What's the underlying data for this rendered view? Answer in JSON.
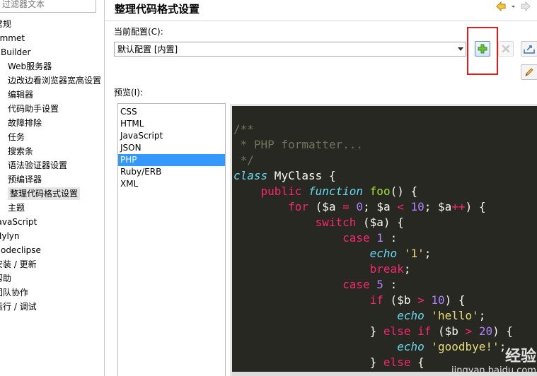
{
  "sidebar": {
    "filter_placeholder": "过滤器文本",
    "items": [
      {
        "label": "常规",
        "indent": 0
      },
      {
        "label": "Emmet",
        "indent": 0
      },
      {
        "label": "HBuilder",
        "indent": 0
      },
      {
        "label": "Web服务器",
        "indent": 1
      },
      {
        "label": "边改边看浏览器宽高设置",
        "indent": 1
      },
      {
        "label": "编辑器",
        "indent": 1
      },
      {
        "label": "代码助手设置",
        "indent": 1
      },
      {
        "label": "故障排除",
        "indent": 1
      },
      {
        "label": "任务",
        "indent": 1
      },
      {
        "label": "搜索条",
        "indent": 1
      },
      {
        "label": "语法验证器设置",
        "indent": 1
      },
      {
        "label": "预编译器",
        "indent": 1
      },
      {
        "label": "整理代码格式设置",
        "indent": 1,
        "selected": true
      },
      {
        "label": "主题",
        "indent": 1
      },
      {
        "label": "JavaScript",
        "indent": 0
      },
      {
        "label": "Mylyn",
        "indent": 0
      },
      {
        "label": "Nodeclipse",
        "indent": 0
      },
      {
        "label": "安装 / 更新",
        "indent": 0
      },
      {
        "label": "帮助",
        "indent": 0
      },
      {
        "label": "团队协作",
        "indent": 0
      },
      {
        "label": "运行 / 调试",
        "indent": 0
      }
    ]
  },
  "page": {
    "title": "整理代码格式设置",
    "current_config_label": "当前配置(C):",
    "current_config_value": "默认配置 [内置]",
    "preview_label": "预览(I):",
    "highlight_color": "#e3191c"
  },
  "languages": {
    "items": [
      "CSS",
      "HTML",
      "JavaScript",
      "JSON",
      "PHP",
      "Ruby/ERB",
      "XML"
    ],
    "selected": "PHP"
  },
  "code_preview": {
    "lines": [
      [
        {
          "t": "/**",
          "c": "cm"
        }
      ],
      [
        {
          "t": " * PHP formatter...",
          "c": "cm"
        }
      ],
      [
        {
          "t": " */",
          "c": "cm"
        }
      ],
      [
        {
          "t": "class",
          "c": "kwi"
        },
        {
          "t": " MyClass {",
          "c": ""
        }
      ],
      [
        {
          "t": "    ",
          "c": ""
        },
        {
          "t": "public",
          "c": "kw"
        },
        {
          "t": " ",
          "c": ""
        },
        {
          "t": "function",
          "c": "kwi"
        },
        {
          "t": " ",
          "c": ""
        },
        {
          "t": "foo",
          "c": "fn"
        },
        {
          "t": "() {",
          "c": ""
        }
      ],
      [
        {
          "t": "        ",
          "c": ""
        },
        {
          "t": "for",
          "c": "kw"
        },
        {
          "t": " ($a ",
          "c": ""
        },
        {
          "t": "=",
          "c": "kw"
        },
        {
          "t": " ",
          "c": ""
        },
        {
          "t": "0",
          "c": "num"
        },
        {
          "t": "; $a ",
          "c": ""
        },
        {
          "t": "<",
          "c": "kw"
        },
        {
          "t": " ",
          "c": ""
        },
        {
          "t": "10",
          "c": "num"
        },
        {
          "t": "; $a",
          "c": ""
        },
        {
          "t": "++",
          "c": "kw"
        },
        {
          "t": ") {",
          "c": ""
        }
      ],
      [
        {
          "t": "            ",
          "c": ""
        },
        {
          "t": "switch",
          "c": "kw"
        },
        {
          "t": " ($a) {",
          "c": ""
        }
      ],
      [
        {
          "t": "                ",
          "c": ""
        },
        {
          "t": "case",
          "c": "kw"
        },
        {
          "t": " ",
          "c": ""
        },
        {
          "t": "1",
          "c": "num"
        },
        {
          "t": " :",
          "c": ""
        }
      ],
      [
        {
          "t": "                    ",
          "c": ""
        },
        {
          "t": "echo",
          "c": "kwi"
        },
        {
          "t": " ",
          "c": ""
        },
        {
          "t": "'1'",
          "c": "str"
        },
        {
          "t": ";",
          "c": ""
        }
      ],
      [
        {
          "t": "                    ",
          "c": ""
        },
        {
          "t": "break",
          "c": "kw"
        },
        {
          "t": ";",
          "c": ""
        }
      ],
      [
        {
          "t": "                ",
          "c": ""
        },
        {
          "t": "case",
          "c": "kw"
        },
        {
          "t": " ",
          "c": ""
        },
        {
          "t": "5",
          "c": "num"
        },
        {
          "t": " :",
          "c": ""
        }
      ],
      [
        {
          "t": "                    ",
          "c": ""
        },
        {
          "t": "if",
          "c": "kw"
        },
        {
          "t": " ($b ",
          "c": ""
        },
        {
          "t": ">",
          "c": "kw"
        },
        {
          "t": " ",
          "c": ""
        },
        {
          "t": "10",
          "c": "num"
        },
        {
          "t": ") {",
          "c": ""
        }
      ],
      [
        {
          "t": "                        ",
          "c": ""
        },
        {
          "t": "echo",
          "c": "kwi"
        },
        {
          "t": " ",
          "c": ""
        },
        {
          "t": "'hello'",
          "c": "str"
        },
        {
          "t": ";",
          "c": ""
        }
      ],
      [
        {
          "t": "                    } ",
          "c": ""
        },
        {
          "t": "else",
          "c": "kw"
        },
        {
          "t": " ",
          "c": ""
        },
        {
          "t": "if",
          "c": "kw"
        },
        {
          "t": " ($b ",
          "c": ""
        },
        {
          "t": ">",
          "c": "kw"
        },
        {
          "t": " ",
          "c": ""
        },
        {
          "t": "20",
          "c": "num"
        },
        {
          "t": ") {",
          "c": ""
        }
      ],
      [
        {
          "t": "                        ",
          "c": ""
        },
        {
          "t": "echo",
          "c": "kwi"
        },
        {
          "t": " ",
          "c": ""
        },
        {
          "t": "'goodbye!'",
          "c": "str"
        },
        {
          "t": ";",
          "c": ""
        }
      ],
      [
        {
          "t": "                    } ",
          "c": ""
        },
        {
          "t": "else",
          "c": "kw"
        },
        {
          "t": " {",
          "c": ""
        }
      ]
    ]
  },
  "watermark": {
    "line1": "经验",
    "line2": "jingyan.baidu.com"
  }
}
